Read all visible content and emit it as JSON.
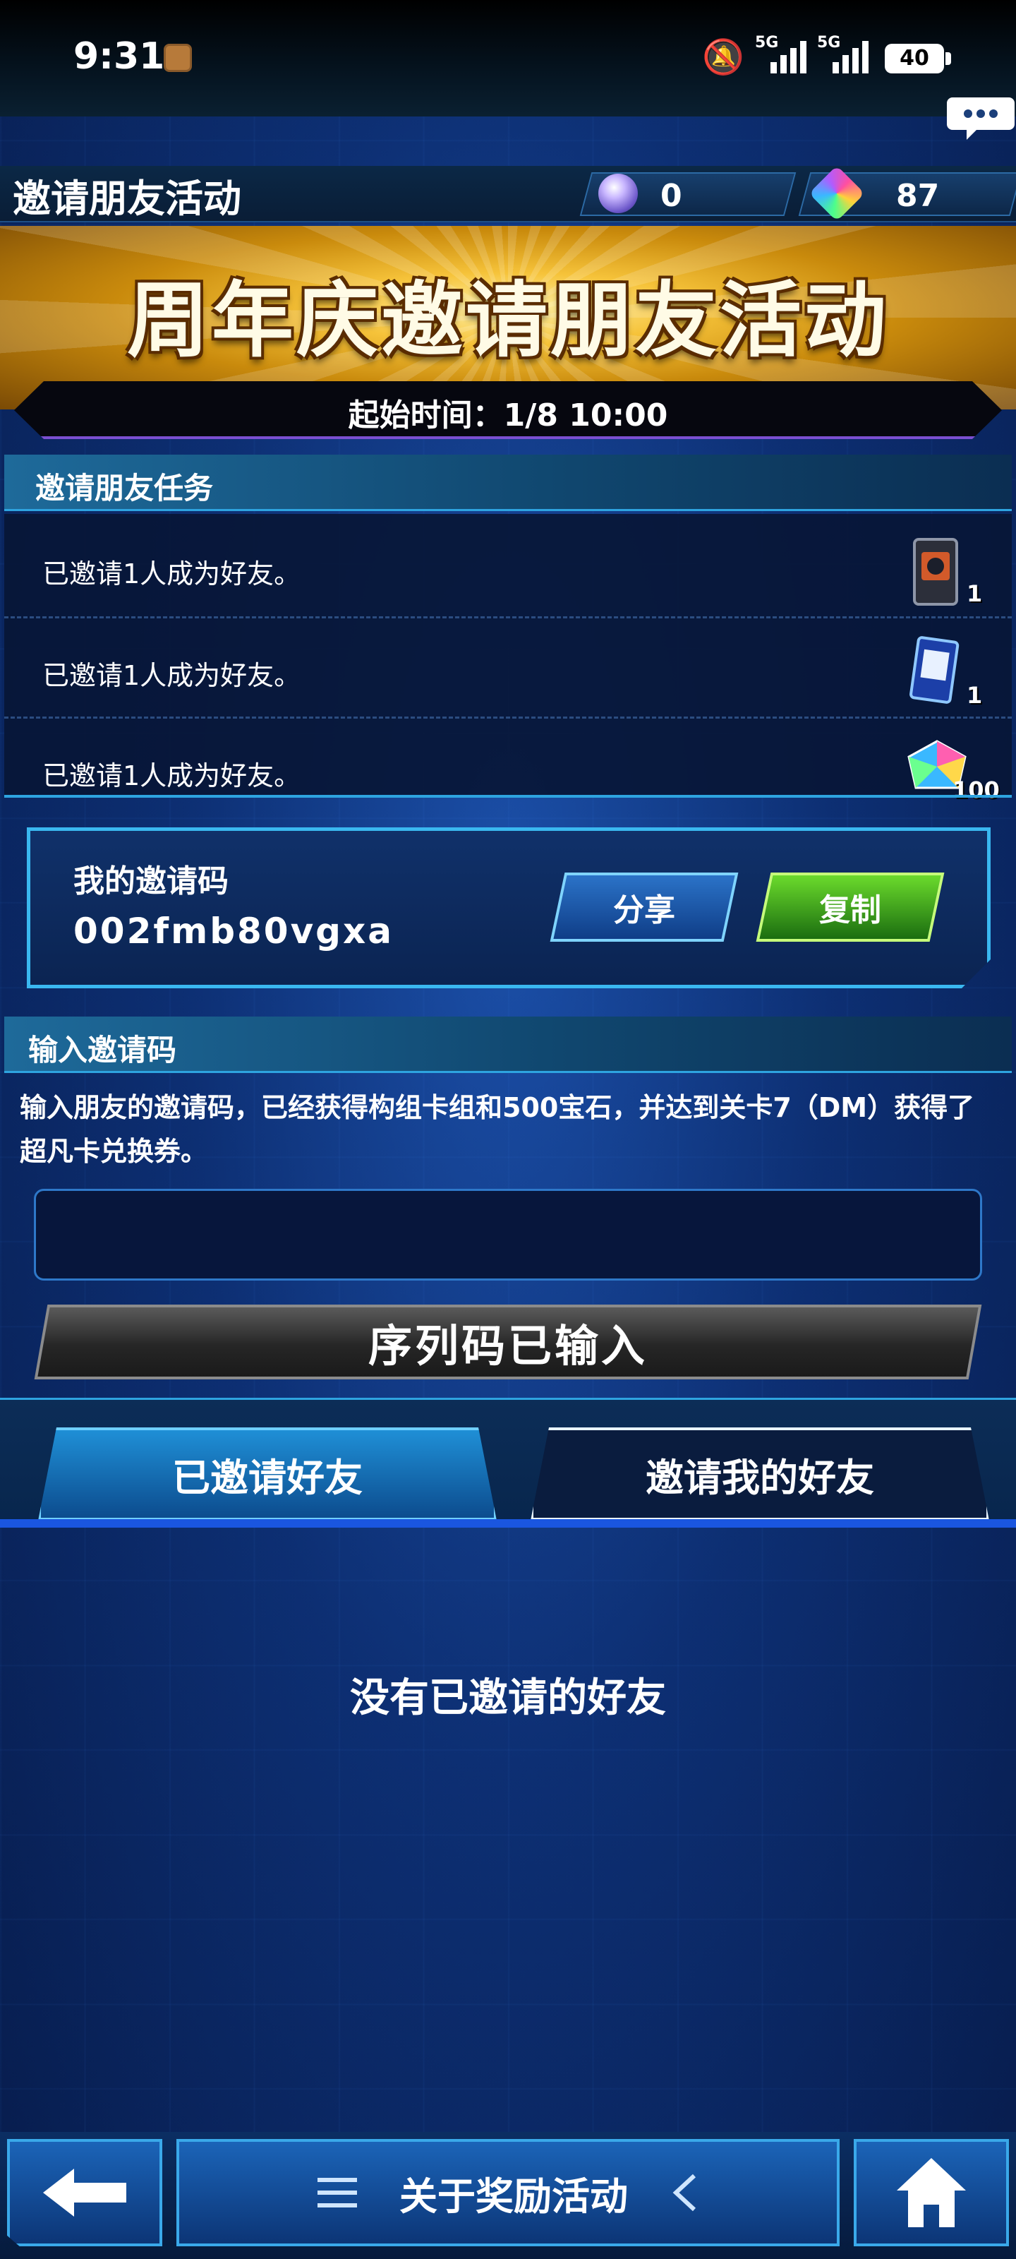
{
  "status_bar": {
    "time": "9:31",
    "signal_1": "5G",
    "signal_2": "5G",
    "battery": "40"
  },
  "header": {
    "title": "邀请朋友活动",
    "currency_orb": "0",
    "currency_gems": "87"
  },
  "banner": {
    "title": "周年庆邀请朋友活动",
    "start_time": "起始时间：1/8 10:00"
  },
  "tasks": {
    "heading": "邀请朋友任务",
    "items": [
      {
        "text": "已邀请1人成为好友。",
        "reward_icon": "card-pack-icon",
        "count": "1"
      },
      {
        "text": "已邀请1人成为好友。",
        "reward_icon": "card-icon",
        "count": "1"
      },
      {
        "text": "已邀请1人成为好友。",
        "reward_icon": "gem-icon",
        "count": "100"
      }
    ]
  },
  "invite_code": {
    "label": "我的邀请码",
    "value": "002fmb80vgxa",
    "share_label": "分享",
    "copy_label": "复制"
  },
  "enter_code": {
    "heading": "输入邀请码",
    "description": "输入朋友的邀请码，已经获得构组卡组和500宝石，并达到关卡7（DM）获得了超凡卡兑换券。",
    "input_value": "",
    "submit_label": "序列码已输入"
  },
  "tabs": [
    {
      "label": "已邀请好友"
    },
    {
      "label": "邀请我的好友"
    }
  ],
  "empty_state": "没有已邀请的好友",
  "bottom_nav": {
    "menu_label": "关于奖励活动"
  },
  "colors": {
    "accent_cyan": "#2ea4e0",
    "copy_green": "#3fae1a",
    "gold": "#f6c33a"
  }
}
